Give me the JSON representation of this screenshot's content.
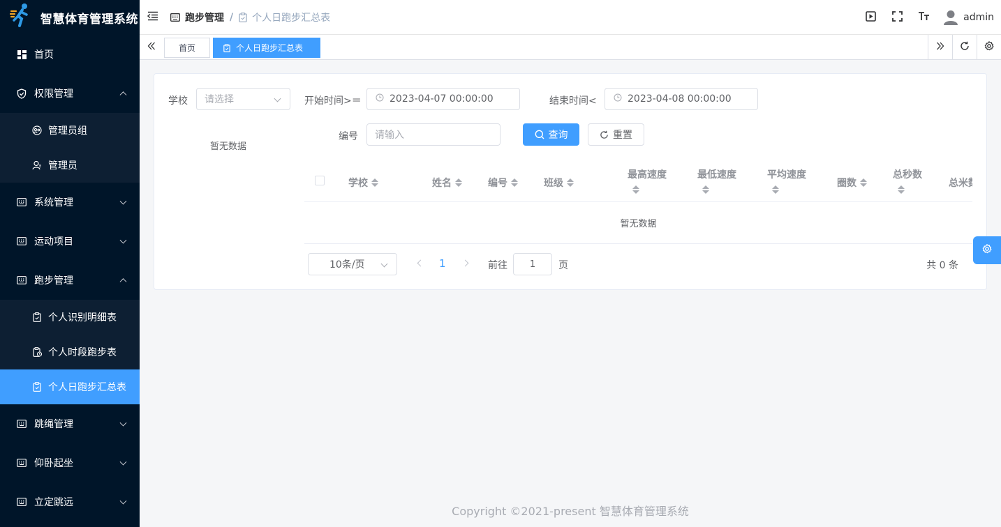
{
  "app": {
    "title": "智慧体育管理系统"
  },
  "sidebar": {
    "items": [
      {
        "label": "首页",
        "icon": "dashboard-icon"
      },
      {
        "label": "权限管理",
        "icon": "shield-icon",
        "expanded": true,
        "children": [
          {
            "label": "管理员组",
            "icon": "user-group-icon"
          },
          {
            "label": "管理员",
            "icon": "user-icon"
          }
        ]
      },
      {
        "label": "系统管理",
        "icon": "keyboard-icon"
      },
      {
        "label": "运动项目",
        "icon": "keyboard-icon"
      },
      {
        "label": "跑步管理",
        "icon": "keyboard-icon",
        "expanded": true,
        "children": [
          {
            "label": "个人识别明细表",
            "icon": "clipboard-icon"
          },
          {
            "label": "个人时段跑步表",
            "icon": "clipboard-icon"
          },
          {
            "label": "个人日跑步汇总表",
            "icon": "clipboard-icon",
            "active": true
          }
        ]
      },
      {
        "label": "跳绳管理",
        "icon": "keyboard-icon"
      },
      {
        "label": "仰卧起坐",
        "icon": "keyboard-icon"
      },
      {
        "label": "立定跳远",
        "icon": "keyboard-icon"
      }
    ]
  },
  "header": {
    "breadcrumb": [
      "跑步管理",
      "个人日跑步汇总表"
    ],
    "username": "admin"
  },
  "tags": {
    "home": "首页",
    "active": "个人日跑步汇总表"
  },
  "filters": {
    "school_label": "学校",
    "school_placeholder": "请选择",
    "school_empty": "暂无数据",
    "start_label": "开始时间>＝",
    "start_value": "2023-04-07 00:00:00",
    "end_label": "结束时间<",
    "end_value": "2023-04-08 00:00:00",
    "id_label": "编号",
    "id_placeholder": "请输入",
    "search_button": "查询",
    "reset_button": "重置"
  },
  "table": {
    "columns": [
      "学校",
      "姓名",
      "编号",
      "班级",
      "最高速度",
      "最低速度",
      "平均速度",
      "圈数",
      "总秒数",
      "总米数"
    ],
    "empty_text": "暂无数据"
  },
  "pagination": {
    "page_size": "10条/页",
    "current_page": "1",
    "goto_label": "前往",
    "goto_value": "1",
    "page_suffix": "页",
    "total_text": "共 0 条"
  },
  "footer": {
    "copyright": "Copyright ©2021-present 智慧体育管理系统"
  },
  "colors": {
    "sidebar_bg": "#001529",
    "primary": "#409eff"
  }
}
